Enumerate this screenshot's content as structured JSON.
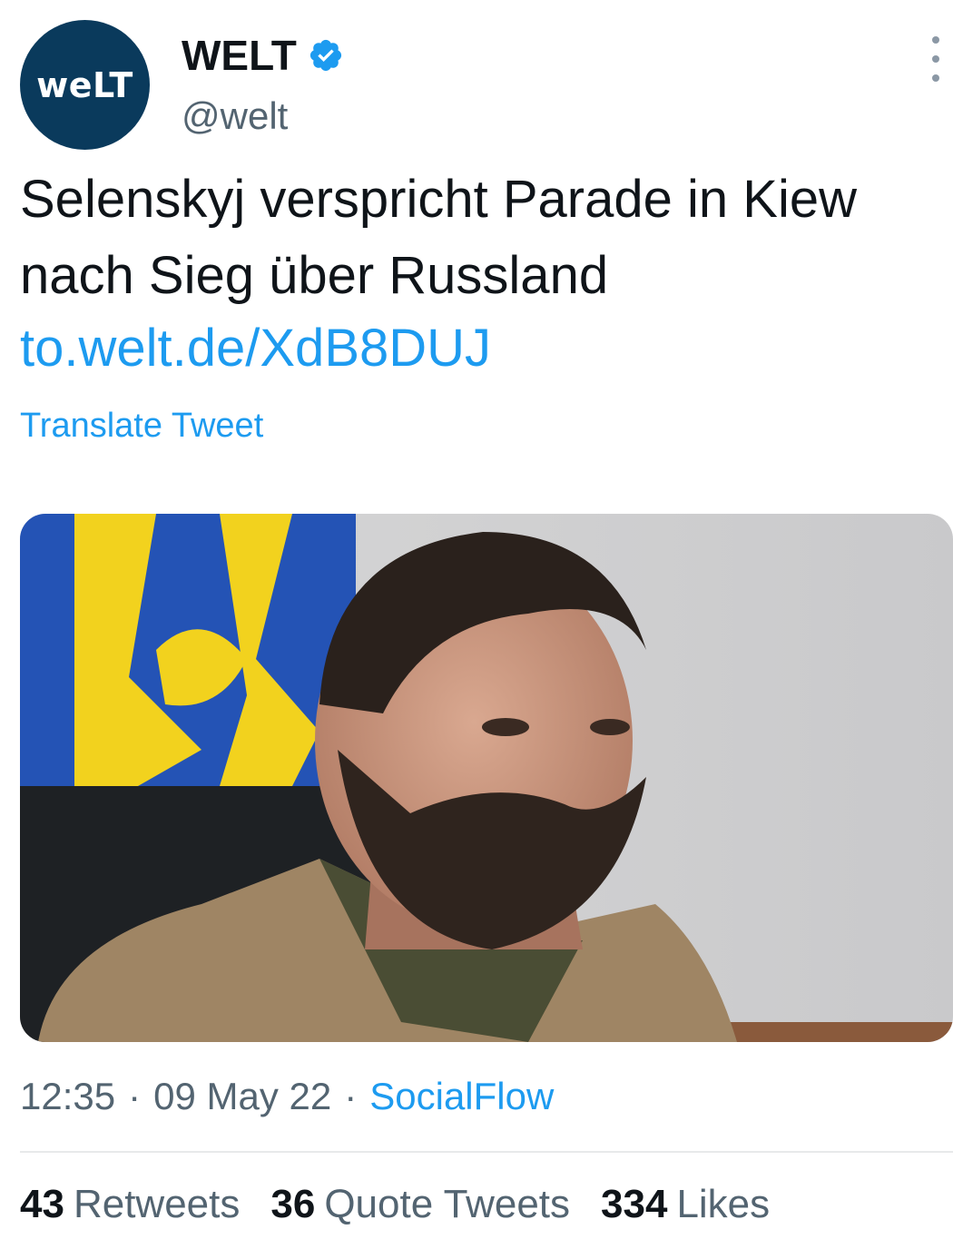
{
  "account": {
    "avatar_text": "weLT",
    "display_name": "WELT",
    "handle": "@welt",
    "verified": true
  },
  "tweet": {
    "text": "Selenskyj verspricht Parade in Kiew nach Sieg über Russland",
    "link": "to.welt.de/XdB8DUJ",
    "translate_label": "Translate Tweet",
    "time": "12:35",
    "separator": "·",
    "date": "09 May 22",
    "source": "SocialFlow"
  },
  "stats": {
    "retweets_count": "43",
    "retweets_label": "Retweets",
    "quotes_count": "36",
    "quotes_label": "Quote Tweets",
    "likes_count": "334",
    "likes_label": "Likes"
  },
  "icons": {
    "verified": "verified-badge-icon",
    "more": "more-options-icon"
  },
  "colors": {
    "brand_blue": "#1d9bf0",
    "avatar_bg": "#0a3a5c",
    "muted_text": "#536471"
  }
}
